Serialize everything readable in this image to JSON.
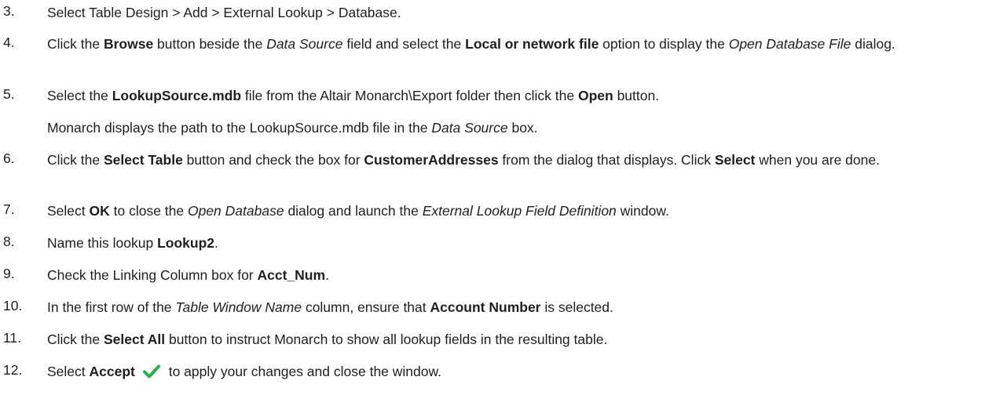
{
  "steps": [
    {
      "number": "3.",
      "segments": [
        {
          "t": "Select Table Design > Add > External Lookup > Database."
        }
      ]
    },
    {
      "number": "4.",
      "segments": [
        {
          "t": "Click the "
        },
        {
          "t": "Browse",
          "s": "b"
        },
        {
          "t": " button beside the "
        },
        {
          "t": "Data Source",
          "s": "i"
        },
        {
          "t": " field and select the "
        },
        {
          "t": "Local or network file",
          "s": "b"
        },
        {
          "t": " option to display the "
        },
        {
          "t": "Open Database File",
          "s": "i"
        },
        {
          "t": " dialog."
        }
      ]
    },
    {
      "number": "5.",
      "segments": [
        {
          "t": "Select the "
        },
        {
          "t": "LookupSource.mdb",
          "s": "b"
        },
        {
          "t": " file from the Altair Monarch\\Export folder then click the "
        },
        {
          "t": "Open",
          "s": "b"
        },
        {
          "t": " button."
        }
      ]
    },
    {
      "number": "",
      "segments": [
        {
          "t": "Monarch displays the path to the LookupSource.mdb file in the "
        },
        {
          "t": "Data Source",
          "s": "i"
        },
        {
          "t": " box."
        }
      ]
    },
    {
      "number": "6.",
      "segments": [
        {
          "t": "Click the "
        },
        {
          "t": "Select Table",
          "s": "b"
        },
        {
          "t": " button and check the box for "
        },
        {
          "t": "CustomerAddresses",
          "s": "b"
        },
        {
          "t": " from the dialog that displays. Click "
        },
        {
          "t": "Select",
          "s": "b"
        },
        {
          "t": " when you are done."
        }
      ]
    },
    {
      "number": "7.",
      "segments": [
        {
          "t": "Select "
        },
        {
          "t": "OK",
          "s": "b"
        },
        {
          "t": " to close the "
        },
        {
          "t": "Open Database",
          "s": "i"
        },
        {
          "t": " dialog and launch the "
        },
        {
          "t": "External Lookup Field Definition",
          "s": "i"
        },
        {
          "t": " window."
        }
      ]
    },
    {
      "number": "8.",
      "segments": [
        {
          "t": "Name this lookup "
        },
        {
          "t": "Lookup2",
          "s": "b"
        },
        {
          "t": "."
        }
      ]
    },
    {
      "number": "9.",
      "segments": [
        {
          "t": "Check the Linking Column box for "
        },
        {
          "t": "Acct_Num",
          "s": "b"
        },
        {
          "t": "."
        }
      ]
    },
    {
      "number": "10.",
      "segments": [
        {
          "t": "In the first row of the "
        },
        {
          "t": "Table Window Name",
          "s": "i"
        },
        {
          "t": " column, ensure that "
        },
        {
          "t": "Account Number",
          "s": "b"
        },
        {
          "t": " is selected."
        }
      ]
    },
    {
      "number": "11.",
      "segments": [
        {
          "t": "Click the "
        },
        {
          "t": "Select All",
          "s": "b"
        },
        {
          "t": " button to instruct Monarch to show all lookup fields in the resulting table."
        }
      ]
    },
    {
      "number": "12.",
      "segments": [
        {
          "t": "Select "
        },
        {
          "t": "Accept",
          "s": "b"
        },
        {
          "icon": "checkmark-icon"
        },
        {
          "t": " to apply your changes and close the window."
        }
      ]
    }
  ],
  "colors": {
    "text": "#1f1f1f",
    "check": "#22b14c"
  }
}
